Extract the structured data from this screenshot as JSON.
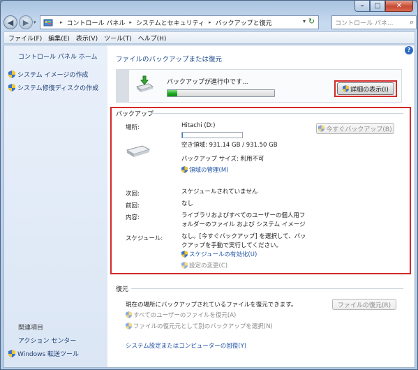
{
  "window": {
    "minimize_label": "–",
    "maximize_label": "□",
    "close_label": "✕"
  },
  "nav": {
    "back_label": "◀",
    "forward_label": "▶",
    "dropdown_label": "▾",
    "breadcrumbs": [
      "コントロール パネル",
      "システムとセキュリティ",
      "バックアップと復元"
    ],
    "separator": "▸",
    "address_dropdown": "▾",
    "refresh_label": "↻",
    "search_placeholder": "コントロール パネ...",
    "search_icon_label": "⌕"
  },
  "menubar": {
    "items": [
      "ファイル(F)",
      "編集(E)",
      "表示(V)",
      "ツール(T)",
      "ヘルプ(H)"
    ]
  },
  "sidebar": {
    "home_link": "コントロール パネル ホーム",
    "task_links": [
      "システム イメージの作成",
      "システム修復ディスクの作成"
    ],
    "related_heading": "関連項目",
    "related_links": [
      "アクション センター",
      "Windows 転送ツール"
    ]
  },
  "main": {
    "help_label": "?",
    "title": "ファイルのバックアップまたは復元",
    "progress": {
      "status_text": "バックアップが進行中です...",
      "progress_fraction": 0.09,
      "details_button": "詳細の表示(I)"
    },
    "backup": {
      "section_title": "バックアップ",
      "location_label": "場所:",
      "location_value": "Hitachi (D:)",
      "drive_used_fraction": 0.002,
      "free_space": "空き領域: 931.14 GB / 931.50 GB",
      "backup_size": "バックアップ サイズ: 利用不可",
      "manage_space_link": "領域の管理(M)",
      "backup_now_button": "今すぐバックアップ(B)",
      "next_label": "次回:",
      "next_value": "スケジュールされていません",
      "last_label": "前回:",
      "last_value": "なし",
      "contents_label": "内容:",
      "contents_line1": "ライブラリおよびすべてのユーザーの個人用フ",
      "contents_line2": "ォルダーのファイル および システム イメージ",
      "schedule_label": "スケジュール:",
      "schedule_line1": "なし。[今すぐバックアップ] を選択して、バッ",
      "schedule_line2": "クアップを手動で実行してください。",
      "enable_schedule_link": "スケジュールの有効化(U)",
      "change_settings_link": "設定の変更(C)"
    },
    "restore": {
      "section_title": "復元",
      "description": "現在の場所にバックアップされているファイルを復元できます。",
      "restore_files_button": "ファイルの復元(R)",
      "all_users_link": "すべてのユーザーのファイルを復元(A)",
      "select_other_link": "ファイルの復元元として別のバックアップを選択(N)",
      "system_recovery_link": "システム設定またはコンピューターの回復(Y)"
    }
  },
  "colors": {
    "accent": "#1f52a5",
    "highlight_box": "#d42a2a",
    "progress_fill": "#1aa31a"
  }
}
